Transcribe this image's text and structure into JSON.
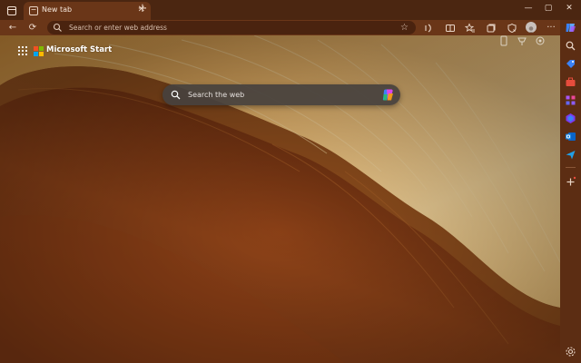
{
  "window": {
    "tab": {
      "title": "New tab",
      "close_glyph": "✕"
    },
    "new_tab_glyph": "+",
    "controls": {
      "minimize": "—",
      "maximize": "▢",
      "close": "✕"
    }
  },
  "toolbar": {
    "back_glyph": "←",
    "refresh_glyph": "⟳",
    "address_placeholder": "Search or enter web address",
    "more_glyph": "···"
  },
  "page": {
    "brand": "Microsoft Start",
    "search_placeholder": "Search the web"
  },
  "sidebar": {
    "items": [
      "search-icon",
      "tag-icon",
      "briefcase-icon",
      "games-icon",
      "copilot-shield-icon",
      "outlook-icon",
      "send-icon",
      "add-icon",
      "settings-icon"
    ]
  },
  "colors": {
    "titlebar": "#4b2611",
    "toolbar": "#6a3618",
    "sidebar": "#5c2d13",
    "searchbox": "#46413e"
  }
}
